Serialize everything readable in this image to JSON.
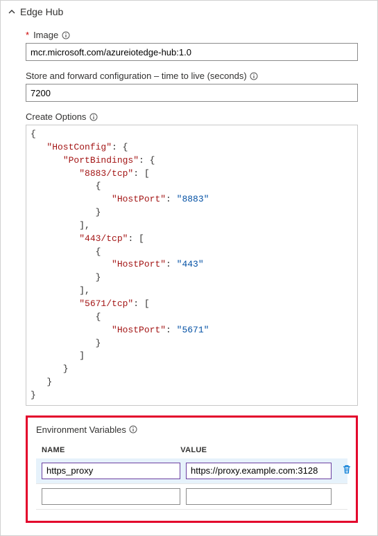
{
  "section": {
    "title": "Edge Hub"
  },
  "image": {
    "label": "Image",
    "required_marker": "*",
    "value": "mcr.microsoft.com/azureiotedge-hub:1.0"
  },
  "ttl": {
    "label": "Store and forward configuration – time to live (seconds)",
    "value": "7200"
  },
  "createOptions": {
    "label": "Create Options",
    "json_text": "{\n   \"HostConfig\": {\n      \"PortBindings\": {\n         \"8883/tcp\": [\n            {\n               \"HostPort\": \"8883\"\n            }\n         ],\n         \"443/tcp\": [\n            {\n               \"HostPort\": \"443\"\n            }\n         ],\n         \"5671/tcp\": [\n            {\n               \"HostPort\": \"5671\"\n            }\n         ]\n      }\n   }\n}",
    "json_struct": {
      "HostConfig": {
        "PortBindings": {
          "8883/tcp": [
            {
              "HostPort": "8883"
            }
          ],
          "443/tcp": [
            {
              "HostPort": "443"
            }
          ],
          "5671/tcp": [
            {
              "HostPort": "5671"
            }
          ]
        }
      }
    }
  },
  "env": {
    "label": "Environment Variables",
    "columns": {
      "name": "NAME",
      "value": "VALUE"
    },
    "rows": [
      {
        "name": "https_proxy",
        "value": "https://proxy.example.com:3128",
        "selected": true,
        "deletable": true
      },
      {
        "name": "",
        "value": "",
        "selected": false,
        "deletable": false
      }
    ]
  }
}
